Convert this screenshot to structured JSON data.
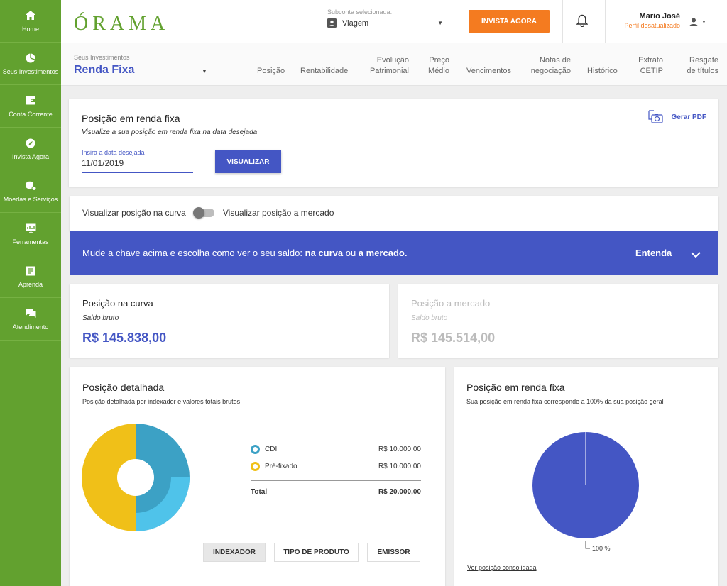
{
  "colors": {
    "brand_green": "#62a12f",
    "accent_orange": "#f47b20",
    "primary_blue": "#4456c4",
    "cdi": "#3ca1c5",
    "prefixado": "#f0c018"
  },
  "sidebar": {
    "items": [
      {
        "label": "Home",
        "icon": "home-icon"
      },
      {
        "label": "Seus Investimentos",
        "icon": "pie-chart-icon"
      },
      {
        "label": "Conta Corrente",
        "icon": "wallet-icon"
      },
      {
        "label": "Invista Agora",
        "icon": "compass-icon"
      },
      {
        "label": "Moedas e Serviços",
        "icon": "coins-icon"
      },
      {
        "label": "Ferramentas",
        "icon": "monitor-chart-icon"
      },
      {
        "label": "Aprenda",
        "icon": "book-icon"
      },
      {
        "label": "Atendimento",
        "icon": "chat-icon"
      }
    ]
  },
  "header": {
    "logo": "ÓRAMA",
    "subconta_label": "Subconta selecionada:",
    "subconta_value": "Viagem",
    "invista_button": "INVISTA AGORA",
    "user_name": "Mario José",
    "user_status": "Perfil desatualizado"
  },
  "subnav": {
    "label": "Seus Investimentos",
    "title": "Renda Fixa",
    "tabs": [
      "Posição",
      "Rentabilidade",
      "Evolução Patrimonial",
      "Preço Médio",
      "Vencimentos",
      "Notas de negociação",
      "Histórico",
      "Extrato CETIP",
      "Resgate de títulos"
    ]
  },
  "position_card": {
    "title": "Posição em renda fixa",
    "subtitle": "Visualize a sua posição em renda fixa na data desejada",
    "date_label": "Insira a data desejada",
    "date_value": "11/01/2019",
    "button": "VISUALIZAR",
    "pdf_label": "Gerar PDF"
  },
  "toggle": {
    "left_label": "Visualizar posição na curva",
    "right_label": "Visualizar posição a mercado",
    "state": "curva"
  },
  "banner": {
    "text_prefix": "Mude a chave acima e escolha como ver o seu saldo: ",
    "bold1": "na curva",
    "mid": " ou ",
    "bold2": "a mercado.",
    "action": "Entenda"
  },
  "curva": {
    "title": "Posição na curva",
    "subtitle": "Saldo bruto",
    "value": "R$ 145.838,00"
  },
  "mercado": {
    "title": "Posição a mercado",
    "subtitle": "Saldo bruto",
    "value": "R$ 145.514,00"
  },
  "detalhada": {
    "title": "Posição detalhada",
    "subtitle": "Posição detalhada por indexador e valores totais brutos",
    "legend": [
      {
        "name": "CDI",
        "value": "R$ 10.000,00"
      },
      {
        "name": "Pré-fixado",
        "value": "R$ 10.000,00"
      }
    ],
    "total_label": "Total",
    "total_value": "R$ 20.000,00",
    "buttons": [
      "INDEXADOR",
      "TIPO DE PRODUTO",
      "EMISSOR"
    ],
    "active_button": "INDEXADOR"
  },
  "renda_fixa_chart": {
    "title": "Posição em renda fixa",
    "subtitle": "Sua posição em renda fixa corresponde a 100% da sua posição geral",
    "slice_label": "100 %",
    "link": "Ver posição consolidada"
  },
  "chart_data": [
    {
      "type": "pie",
      "categories": [
        "CDI",
        "Pré-fixado"
      ],
      "values": [
        10000,
        10000
      ]
    },
    {
      "type": "pie",
      "categories": [
        "Renda fixa"
      ],
      "values": [
        100
      ]
    }
  ]
}
